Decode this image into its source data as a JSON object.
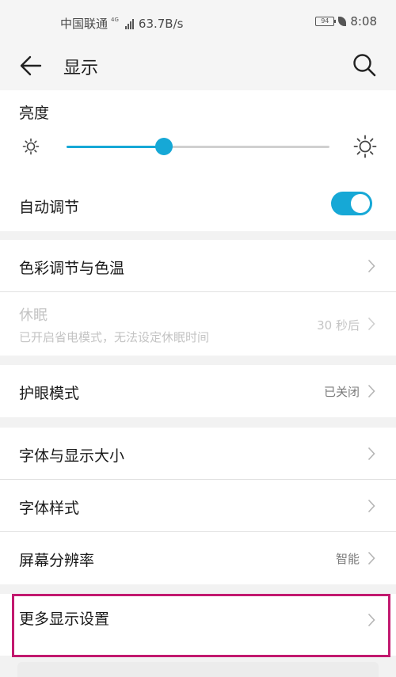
{
  "status_bar": {
    "carrier": "中国联通",
    "network": "4G",
    "speed": "63.7B/s",
    "battery": "94",
    "time": "8:08"
  },
  "app_bar": {
    "title": "显示"
  },
  "brightness": {
    "title": "亮度",
    "level_fraction": 0.37,
    "auto_label": "自动调节",
    "auto_on": true
  },
  "color": {
    "label": "色彩调节与色温"
  },
  "sleep": {
    "title": "休眠",
    "subtitle": "已开启省电模式，无法设定休眠时间",
    "value": "30 秒后"
  },
  "eye_care": {
    "label": "护眼模式",
    "value": "已关闭"
  },
  "font_size": {
    "label": "字体与显示大小"
  },
  "font_style": {
    "label": "字体样式"
  },
  "resolution": {
    "label": "屏幕分辨率",
    "value": "智能"
  },
  "more_display": {
    "label": "更多显示设置"
  },
  "colors": {
    "accent": "#16a8d6",
    "highlight": "#c2196f"
  }
}
